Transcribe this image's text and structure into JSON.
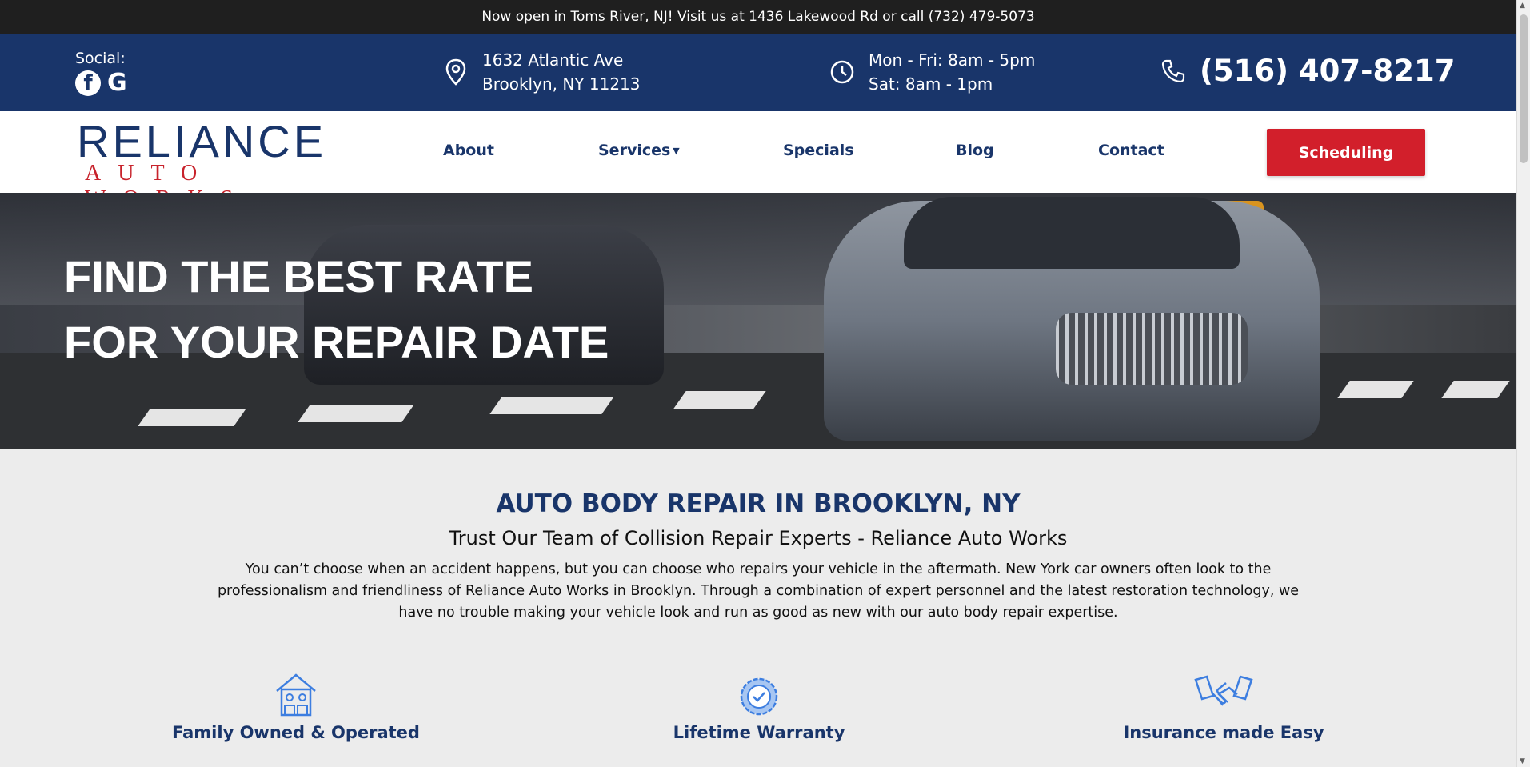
{
  "announcement": "Now open in Toms River, NJ! Visit us at 1436 Lakewood Rd or call (732) 479-5073",
  "social": {
    "label": "Social:",
    "icons": [
      "facebook-icon",
      "google-icon"
    ]
  },
  "address": {
    "line1": "1632 Atlantic Ave",
    "line2": "Brooklyn, NY 11213"
  },
  "hours": {
    "line1": "Mon - Fri: 8am - 5pm",
    "line2": "Sat: 8am - 1pm"
  },
  "phone": "(516) 407-8217",
  "logo": {
    "main": "RELIANCE",
    "sub": "AUTO WORKS"
  },
  "nav": {
    "items": [
      {
        "label": "About"
      },
      {
        "label": "Services"
      },
      {
        "label": "Specials"
      },
      {
        "label": "Blog"
      },
      {
        "label": "Contact"
      }
    ],
    "cta": "Scheduling"
  },
  "hero": {
    "line1": "FIND THE BEST RATE",
    "line2": "FOR YOUR REPAIR DATE"
  },
  "main": {
    "heading": "AUTO BODY REPAIR IN BROOKLYN, NY",
    "subheading": "Trust Our Team of Collision Repair Experts - Reliance Auto Works",
    "paragraph": "You can’t choose when an accident happens, but you can choose who repairs your vehicle in the aftermath. New York car owners often look to the professionalism and friendliness of Reliance Auto Works in Brooklyn. Through a combination of expert personnel and the latest restoration technology, we have no trouble making your vehicle look and run as good as new with our auto body repair expertise."
  },
  "features": [
    {
      "title": "Family Owned & Operated",
      "icon": "family-home-icon"
    },
    {
      "title": "Lifetime Warranty",
      "icon": "badge-check-icon"
    },
    {
      "title": "Insurance made Easy",
      "icon": "handshake-icon"
    }
  ],
  "colors": {
    "navy": "#19356a",
    "red": "#d21f2b",
    "accent_blue": "#3d7ee0"
  }
}
